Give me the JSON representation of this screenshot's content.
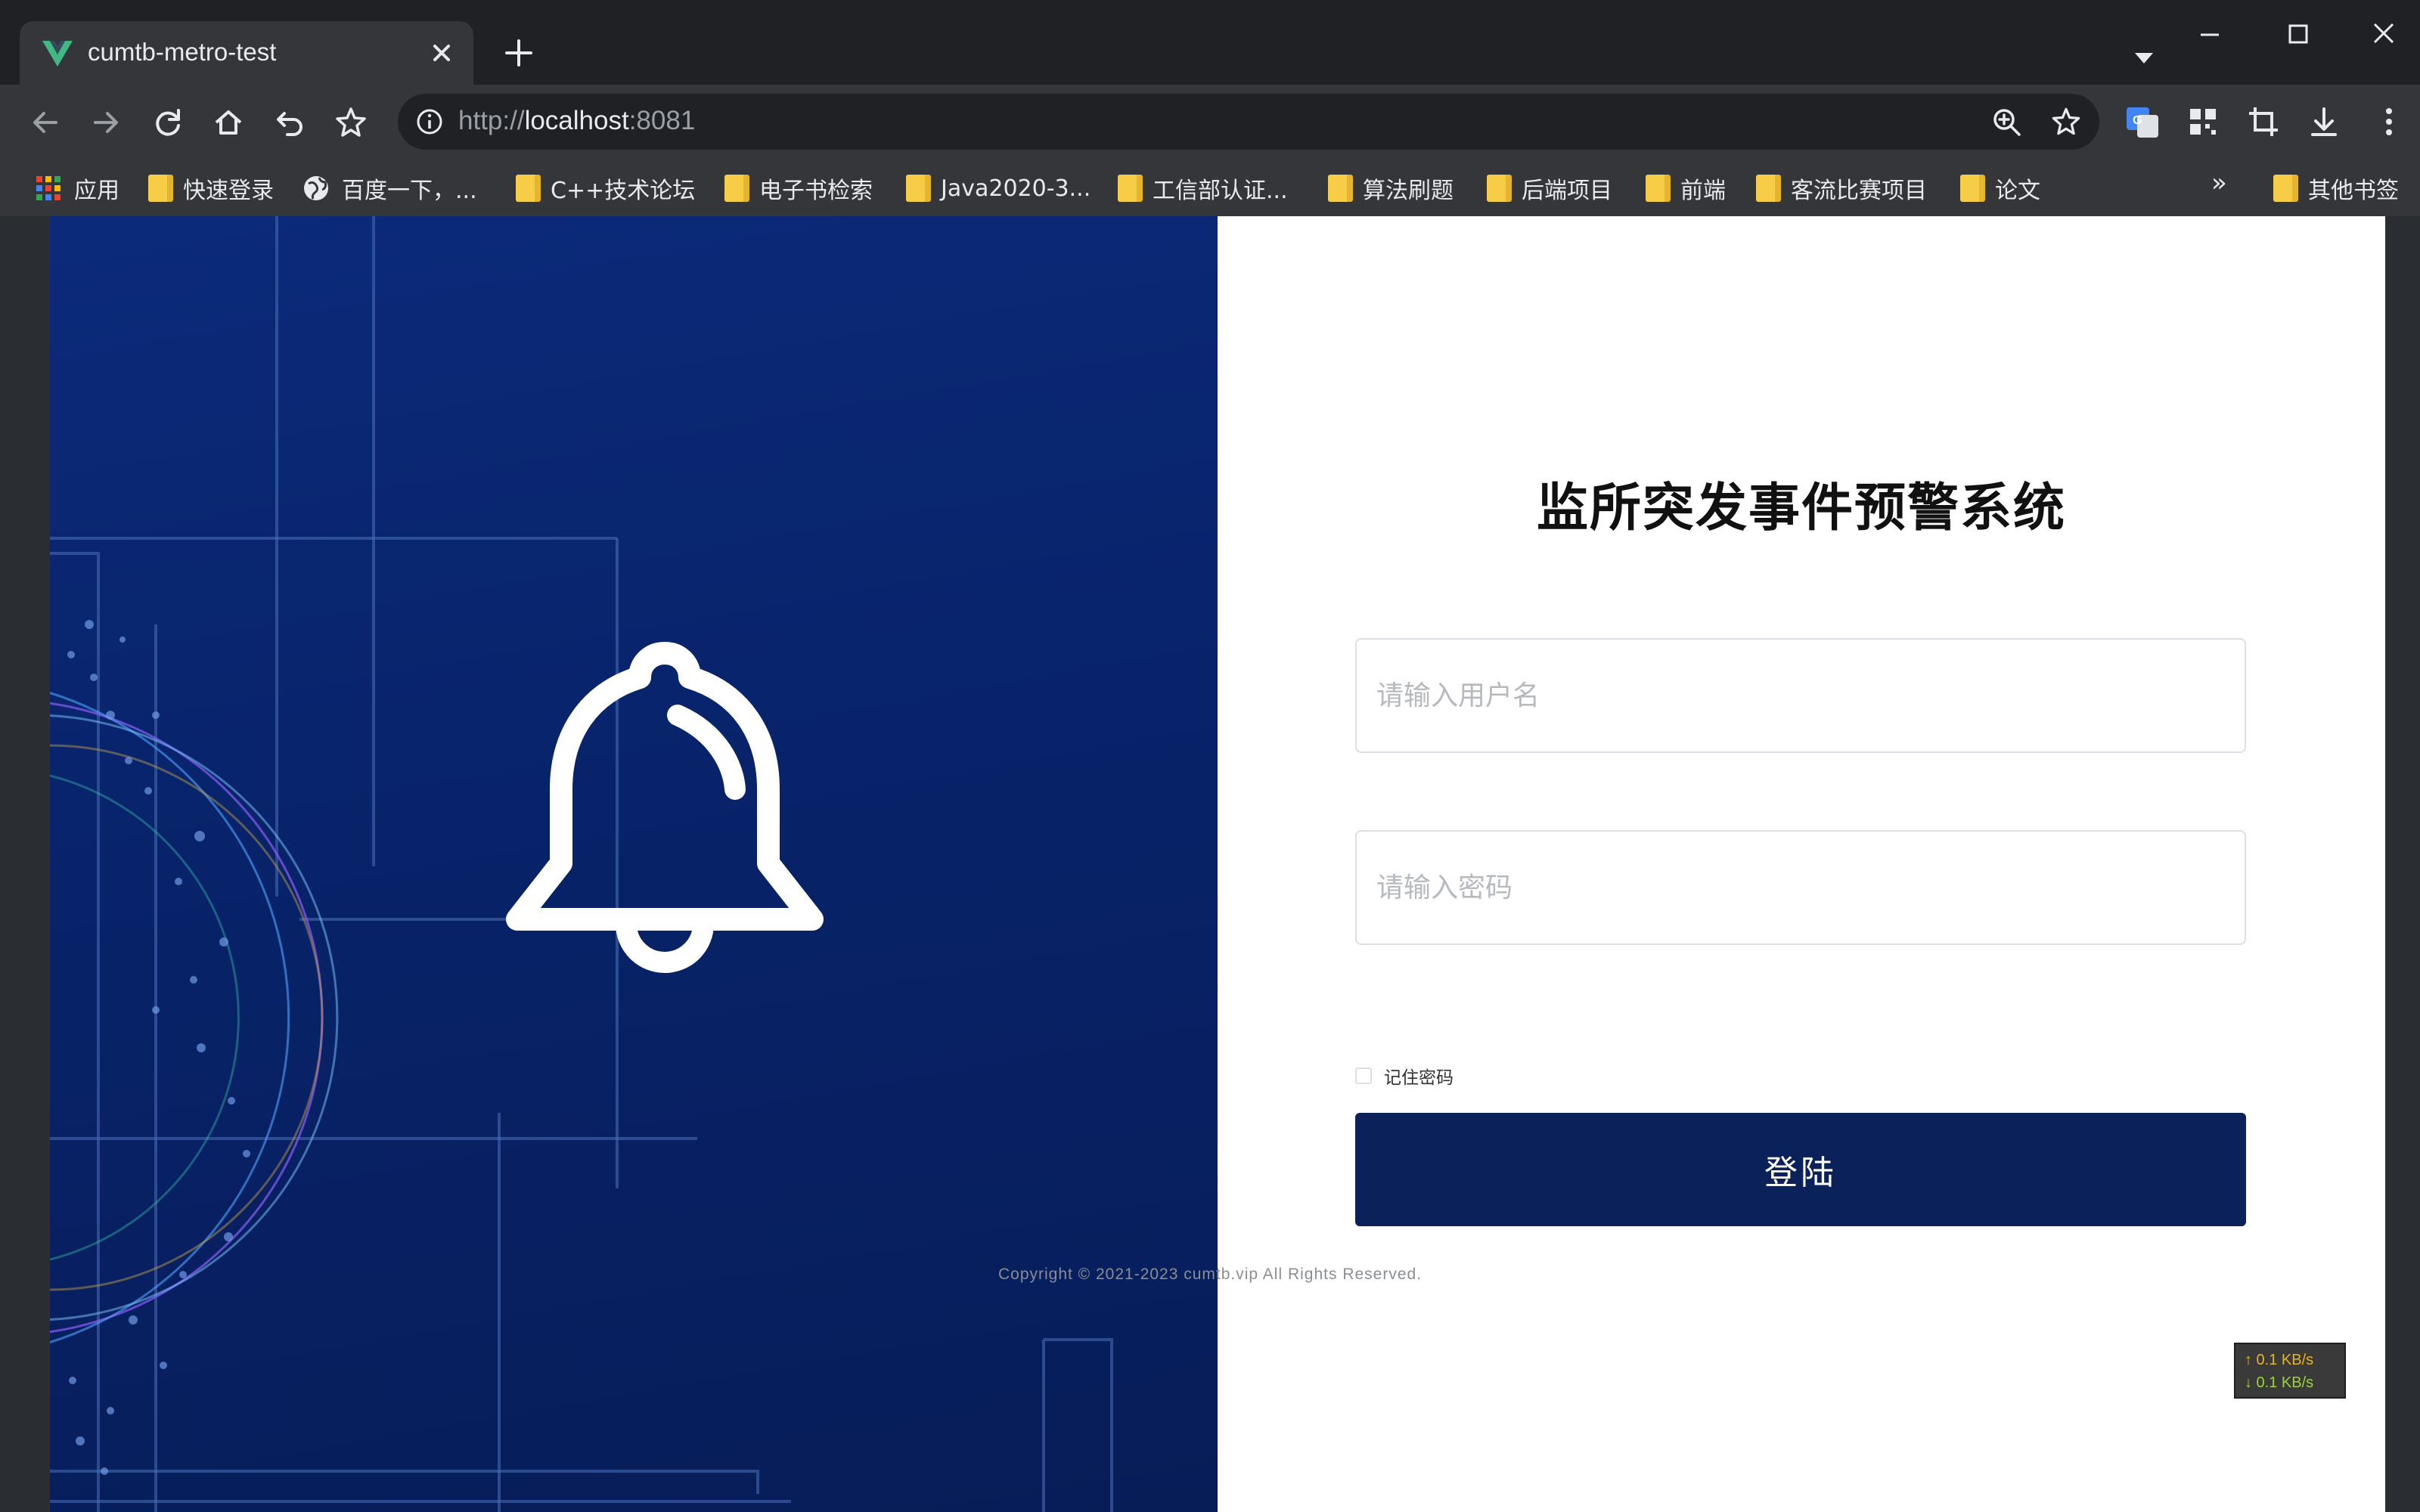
{
  "browser": {
    "tab_title": "cumtb-metro-test",
    "url_scheme": "http://",
    "url_host": "localhost",
    "url_port": ":8081",
    "bookmarks": [
      {
        "label": "应用",
        "icon": "apps-grid-icon"
      },
      {
        "label": "快速登录",
        "icon": "folder-icon"
      },
      {
        "label": "百度一下，...",
        "icon": "globe-icon"
      },
      {
        "label": "C++技术论坛",
        "icon": "folder-icon"
      },
      {
        "label": "电子书检索",
        "icon": "folder-icon"
      },
      {
        "label": "Java2020-3...",
        "icon": "folder-icon"
      },
      {
        "label": "工信部认证...",
        "icon": "folder-icon"
      },
      {
        "label": "算法刷题",
        "icon": "folder-icon"
      },
      {
        "label": "后端项目",
        "icon": "folder-icon"
      },
      {
        "label": "前端",
        "icon": "folder-icon"
      },
      {
        "label": "客流比赛项目",
        "icon": "folder-icon"
      },
      {
        "label": "论文",
        "icon": "folder-icon"
      }
    ],
    "bookmarks_more": "»",
    "other_bookmarks": "其他书签"
  },
  "login": {
    "title": "监所突发事件预警系统",
    "username_placeholder": "请输入用户名",
    "username_value": "",
    "password_placeholder": "请输入密码",
    "password_value": "",
    "remember_label": "记住密码",
    "remember_checked": false,
    "submit_label": "登陆"
  },
  "footer": {
    "copyright": "Copyright © 2021-2023 cumtb.vip All Rights Reserved."
  },
  "netspeed": {
    "up": "↑ 0.1 KB/s",
    "down": "↓ 0.1 KB/s"
  },
  "colors": {
    "hero_bg": "#08236a",
    "button_bg": "#0a2159",
    "favicon_green": "#41b883"
  }
}
